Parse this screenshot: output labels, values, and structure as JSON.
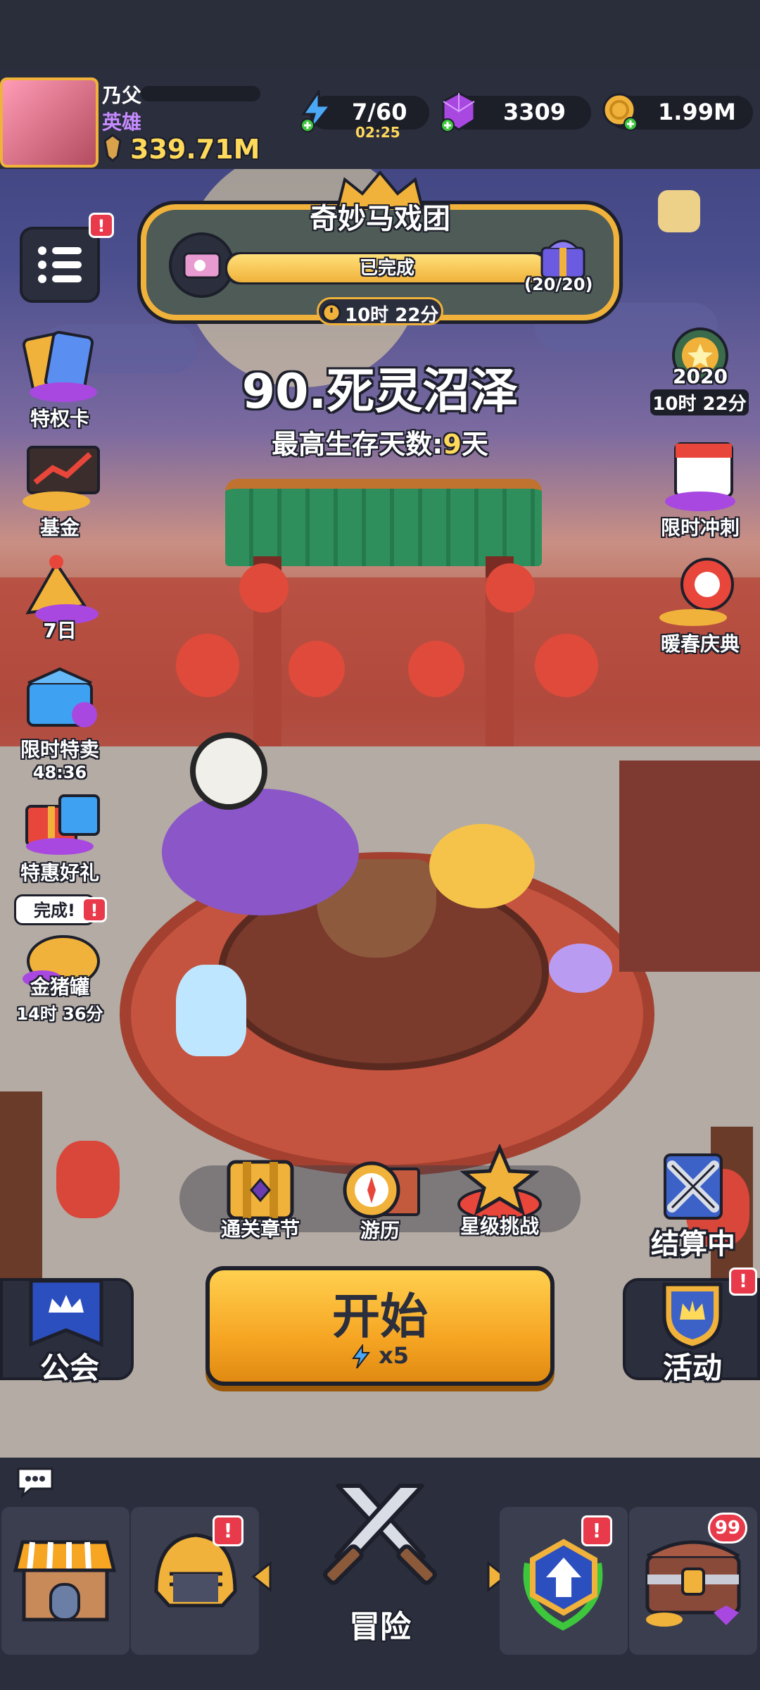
{
  "player": {
    "name": "乃父",
    "title": "英雄",
    "power": "339.71M"
  },
  "resources": {
    "energy": "7/60",
    "energy_timer": "02:25",
    "gems": "3309",
    "gold": "1.99M"
  },
  "event_banner": {
    "title": "奇妙马戏团",
    "status": "已完成",
    "progress_text": "(20/20)",
    "progress": 1.0,
    "timer": "10时 22分"
  },
  "stage": {
    "name": "90.死灵沼泽",
    "best_label": "最高生存天数:",
    "best_value": "9",
    "best_unit": "天"
  },
  "left_menu": [
    {
      "label": "特权卡",
      "icon": "privilege-card-icon"
    },
    {
      "label": "基金",
      "icon": "fund-chart-icon"
    },
    {
      "label": "7日",
      "icon": "seven-day-party-icon"
    },
    {
      "label": "限时特卖",
      "sub": "48:36",
      "icon": "limited-sale-icon"
    },
    {
      "label": "特惠好礼",
      "icon": "gift-box-icon"
    },
    {
      "label": "金猪罐",
      "sub": "14时 36分",
      "bubble": "完成!",
      "icon": "golden-pig-icon"
    }
  ],
  "right_menu": [
    {
      "label": "2020",
      "sub": "10时 22分",
      "icon": "star-medal-icon"
    },
    {
      "label": "限时冲刺",
      "icon": "calendar-sprint-icon"
    },
    {
      "label": "暖春庆典",
      "icon": "lion-dance-icon"
    }
  ],
  "mode_buttons": [
    {
      "label": "通关章节",
      "icon": "chapter-chest-icon"
    },
    {
      "label": "游历",
      "icon": "compass-map-icon"
    },
    {
      "label": "星级挑战",
      "icon": "star-challenge-icon"
    }
  ],
  "settle": {
    "label": "结算中"
  },
  "guild": {
    "label": "公会"
  },
  "activity": {
    "label": "活动"
  },
  "start": {
    "label": "开始",
    "cost": "x5"
  },
  "bottom_nav": {
    "center_label": "冒险",
    "chest_badge": "99"
  },
  "badges": {
    "alert": "!"
  },
  "colors": {
    "start_button": "#f6a623",
    "accent_gold": "#f0b23a",
    "alert_red": "#e83a4a",
    "gem_purple": "#a948e0"
  }
}
